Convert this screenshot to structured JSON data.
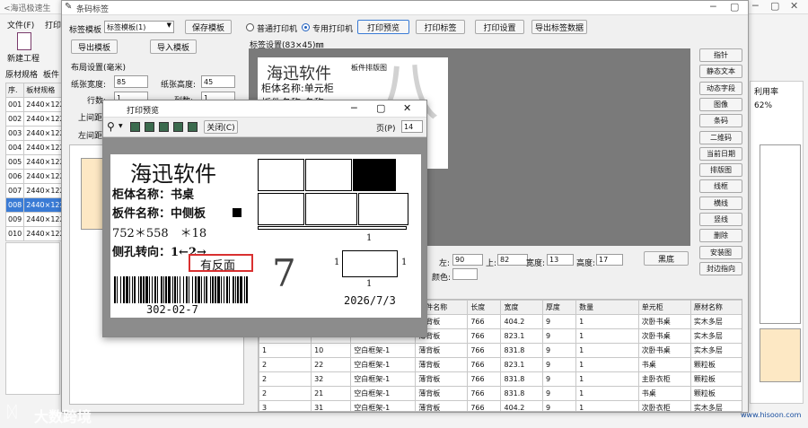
{
  "bg_app": {
    "title": "<海迅极速生",
    "menu": [
      "文件(F)",
      "打印"
    ],
    "new_project": "新建工程",
    "tabs": [
      "原材规格",
      "板件"
    ],
    "list_header": [
      "序.",
      "板材规格"
    ],
    "list_rows": [
      {
        "no": "001",
        "spec": "2440×122"
      },
      {
        "no": "002",
        "spec": "2440×122"
      },
      {
        "no": "003",
        "spec": "2440×122"
      },
      {
        "no": "004",
        "spec": "2440×122"
      },
      {
        "no": "005",
        "spec": "2440×122"
      },
      {
        "no": "006",
        "spec": "2440×122"
      },
      {
        "no": "007",
        "spec": "2440×122"
      },
      {
        "no": "008",
        "spec": "2440×122"
      },
      {
        "no": "009",
        "spec": "2440×122"
      },
      {
        "no": "010",
        "spec": "2440×122"
      }
    ],
    "selected_row": 7,
    "right_header": "利用率",
    "right_value": "62%",
    "website": "www.hisoon.com"
  },
  "main_dialog": {
    "title": "条码标签",
    "template_label": "标签模板",
    "template_value": "标签模板(1)",
    "save_template": "保存模板",
    "export_template": "导出模板",
    "import_template": "导入模板",
    "radio_normal": "普通打印机",
    "radio_special": "专用打印机",
    "print_preview": "打印预览",
    "print_label": "打印标签",
    "print_settings": "打印设置",
    "export_data": "导出标签数据",
    "layout_title": "布局设置(毫米)",
    "paper_width_label": "纸张宽度:",
    "paper_width": "85",
    "paper_height_label": "纸张高度:",
    "paper_height": "45",
    "rows_label": "行数:",
    "rows_value": "1",
    "cols_label": "列数:",
    "cols_value": "1",
    "top_margin_label": "上间距",
    "left_margin_label": "左间距",
    "label_settings": "标签设置(83×45)㎜",
    "sidebar_buttons": [
      "指针",
      "静态文本",
      "动态字段",
      "图像",
      "条码",
      "二维码",
      "当前日期",
      "排版图",
      "线框",
      "横线",
      "竖线",
      "删除",
      "安装图",
      "封边指向"
    ],
    "canvas_company": "海迅软件",
    "canvas_cabinet": "柜体名称:单元柜",
    "canvas_part": "板件名称:名称",
    "canvas_layout": "板件排版图",
    "pos_left_label": "左:",
    "pos_left": "90",
    "pos_top_label": "上:",
    "pos_top": "82",
    "pos_width_label": "宽度:",
    "pos_width": "13",
    "pos_height_label": "高度:",
    "pos_height": "17",
    "color_label": "颜色:",
    "black_btn": "黑底",
    "table_headers": [
      "",
      "",
      "",
      "板件名称",
      "长度",
      "宽度",
      "厚度",
      "数量",
      "单元柜",
      "原材名称"
    ],
    "table_rows": [
      [
        "",
        "",
        "",
        "薄背板",
        "766",
        "404.2",
        "9",
        "1",
        "次卧书桌",
        "实木多层"
      ],
      [
        "",
        "",
        "",
        "薄背板",
        "766",
        "823.1",
        "9",
        "1",
        "次卧书桌",
        "实木多层"
      ],
      [
        "1",
        "10",
        "空白框架-1",
        "薄背板",
        "766",
        "831.8",
        "9",
        "1",
        "次卧书桌",
        "实木多层"
      ],
      [
        "2",
        "22",
        "空白框架-1",
        "薄背板",
        "766",
        "823.1",
        "9",
        "1",
        "书桌",
        "颗粒板"
      ],
      [
        "2",
        "32",
        "空白框架-1",
        "薄背板",
        "766",
        "831.8",
        "9",
        "1",
        "主卧衣柜",
        "颗粒板"
      ],
      [
        "2",
        "21",
        "空白框架-1",
        "薄背板",
        "766",
        "831.8",
        "9",
        "1",
        "书桌",
        "颗粒板"
      ],
      [
        "3",
        "31",
        "空白框架-1",
        "薄背板",
        "766",
        "404.2",
        "9",
        "1",
        "次卧衣柜",
        "实木多层"
      ]
    ]
  },
  "preview": {
    "title": "打印预览",
    "close_btn": "关闭(C)",
    "page_label": "页(P)",
    "page_value": "14",
    "company": "海迅软件",
    "cabinet": "柜体名称：书桌",
    "part": "板件名称：中侧板",
    "dims": "752＊558　＊18",
    "hole": "侧孔转向：1←2→",
    "has_back": "有反面",
    "big_num": "7",
    "barcode_text": "302-02-7",
    "date": "2026/7/3",
    "edge_top": "1",
    "edge_left": "1",
    "edge_right": "1",
    "edge_bottom": "1"
  },
  "watermark": "大数跨境",
  "colors": {
    "selected": "#3a7bd5",
    "highlight_box": "#d93030",
    "canvas_gray": "#7a7a7a"
  }
}
